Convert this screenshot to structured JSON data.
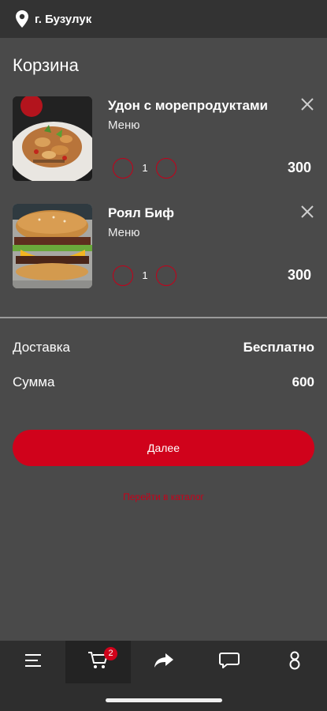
{
  "header": {
    "city": "г. Бузулук",
    "location_icon": "location-pin-icon"
  },
  "page": {
    "title": "Корзина"
  },
  "cart": {
    "items": [
      {
        "name": "Удон с морепродуктами",
        "category": "Меню",
        "quantity": "1",
        "price": "300",
        "image": "udon-seafood-photo"
      },
      {
        "name": "Роял Биф",
        "category": "Меню",
        "quantity": "1",
        "price": "300",
        "image": "royal-beef-burger-photo"
      }
    ]
  },
  "summary": {
    "delivery_label": "Доставка",
    "delivery_value": "Бесплатно",
    "total_label": "Сумма",
    "total_value": "600"
  },
  "actions": {
    "next_label": "Далее",
    "catalog_link": "Перейти в каталог"
  },
  "bottom_nav": {
    "items": [
      {
        "icon": "menu-icon"
      },
      {
        "icon": "cart-icon",
        "badge": "2",
        "active": true
      },
      {
        "icon": "share-icon"
      },
      {
        "icon": "chat-icon"
      },
      {
        "icon": "profile-icon"
      }
    ]
  },
  "colors": {
    "accent": "#d0021b",
    "background": "#4a4a4a",
    "topbar": "#333333",
    "navbar": "#2e2e2e"
  }
}
